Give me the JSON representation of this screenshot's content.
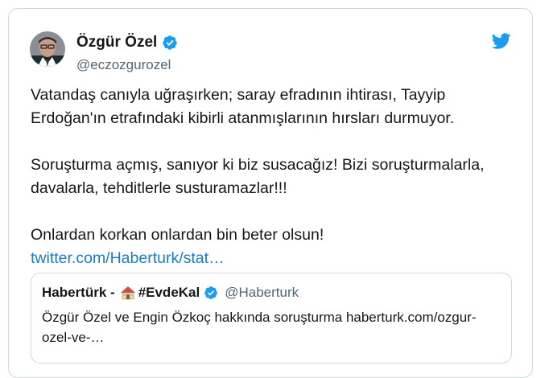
{
  "tweet": {
    "display_name": "Özgür Özel",
    "handle": "@eczozgurozel",
    "paragraphs": [
      "Vatandaş canıyla uğraşırken; saray efradının ihtirası, Tayyip Erdoğan'ın etrafındaki kibirli atanmışlarının hırsları durmuyor.",
      "Soruşturma açmış, sanıyor ki biz susacağız! Bizi soruşturmalarla, davalarla, tehditlerle susturamazlar!!!",
      "Onlardan korkan onlardan bin beter olsun!"
    ],
    "link_text": "twitter.com/Haberturk/stat…",
    "icons": {
      "verified": "verified-badge-icon",
      "brand": "twitter-bird-icon"
    },
    "colors": {
      "verified": "#1d9bf0",
      "brand": "#1d9bf0",
      "link": "#1b7bc6"
    }
  },
  "quoted": {
    "display_name_prefix": "Habertürk - ",
    "hashtag": "#EvdeKal",
    "handle": "@Haberturk",
    "text": "Özgür Özel ve Engin Özkoç hakkında soruşturma haberturk.com/ozgur-ozel-ve-…",
    "emoji_icon": "house-emoji-icon"
  }
}
